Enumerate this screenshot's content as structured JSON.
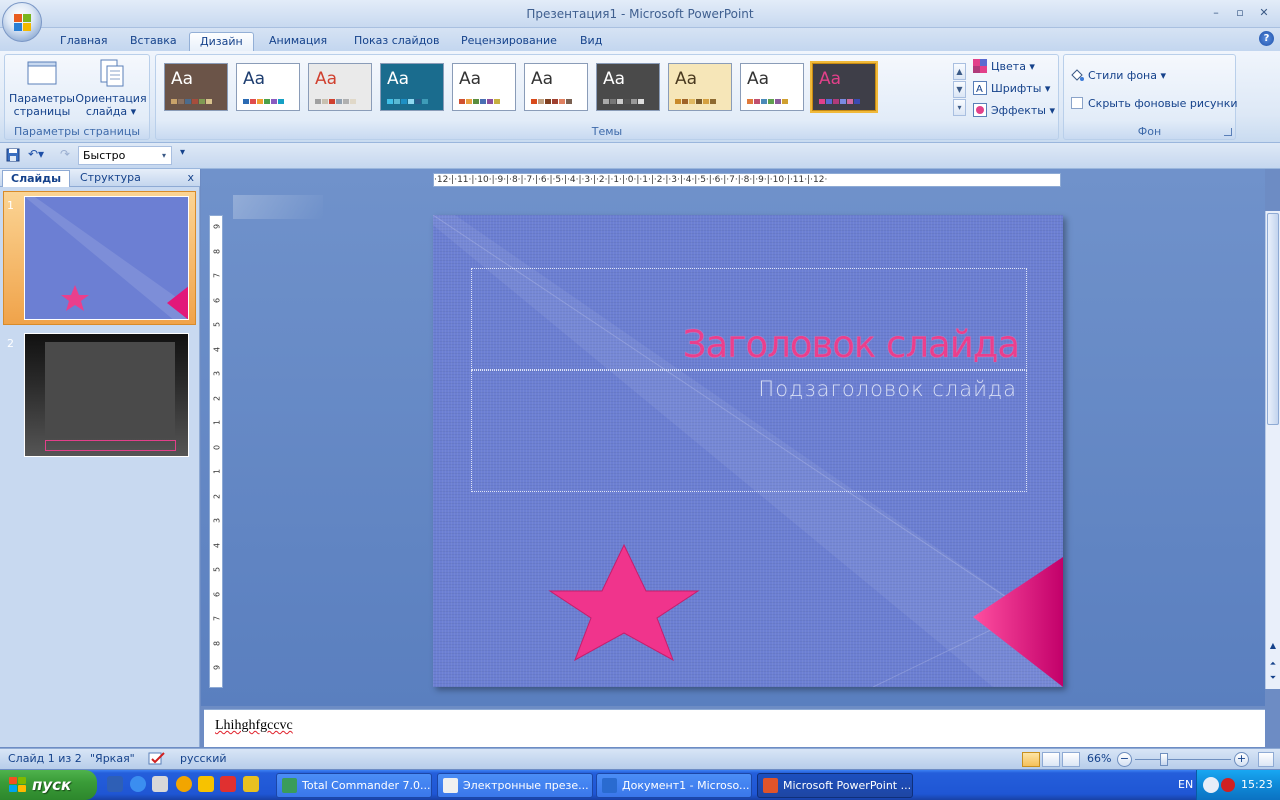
{
  "window": {
    "title": "Презентация1 - Microsoft PowerPoint",
    "ctrl_min": "–",
    "ctrl_max": "▫",
    "ctrl_close": "✕"
  },
  "tabs": [
    "Главная",
    "Вставка",
    "Дизайн",
    "Анимация",
    "Показ слайдов",
    "Рецензирование",
    "Вид"
  ],
  "active_tab": "Дизайн",
  "help": "?",
  "ribbon": {
    "page_setup": {
      "label": "Параметры страницы",
      "params_line1": "Параметры",
      "params_line2": "страницы",
      "orient_line1": "Ориентация",
      "orient_line2": "слайда ▾"
    },
    "themes": {
      "label": "Темы",
      "aa": "Aa",
      "scroll_up": "▲",
      "scroll_down": "▼",
      "scroll_more": "▾",
      "items": [
        {
          "bg": "#6b5448",
          "fg": "#ffffff",
          "sw": [
            "#c9a26a",
            "#8a7060",
            "#4c6b8c",
            "#a64d3c",
            "#7f9b53",
            "#d9c38d"
          ]
        },
        {
          "bg": "#ffffff",
          "fg": "#1e3e70",
          "sw": [
            "#2b6bb3",
            "#e04c4c",
            "#f0a030",
            "#4aa14a",
            "#8a5bc0",
            "#16a0c4"
          ]
        },
        {
          "bg": "#eaeaea",
          "fg": "#d0402f",
          "sw": [
            "#a0a0a0",
            "#c8c0b0",
            "#d0402f",
            "#90a0b0",
            "#b0b0b0",
            "#e0d8c8"
          ]
        },
        {
          "bg": "#1a6c8e",
          "fg": "#ffffff",
          "sw": [
            "#42c0e8",
            "#5ab9d4",
            "#1d8fc4",
            "#8fd8f0",
            "#2a5c8a",
            "#3e9cb8"
          ]
        },
        {
          "bg": "#ffffff",
          "fg": "#333333",
          "sw": [
            "#d05030",
            "#e8a040",
            "#5a8e3e",
            "#4a6fb3",
            "#8c4e9c",
            "#c7b040"
          ]
        },
        {
          "bg": "#ffffff",
          "fg": "#333333",
          "sw": [
            "#d84a1b",
            "#c0a080",
            "#804020",
            "#a04030",
            "#e08060",
            "#7a6050"
          ]
        },
        {
          "bg": "#4a4a4a",
          "fg": "#ffffff",
          "sw": [
            "#aaaaaa",
            "#777777",
            "#cccccc",
            "#555555",
            "#999999",
            "#dddddd"
          ]
        },
        {
          "bg": "#f6e6b8",
          "fg": "#4a3a20",
          "sw": [
            "#c88a2a",
            "#a06428",
            "#e0b860",
            "#7a5a2a",
            "#d4a040",
            "#8e6a30"
          ]
        },
        {
          "bg": "#ffffff",
          "fg": "#333333",
          "sw": [
            "#e07a3a",
            "#c05070",
            "#4a8ab8",
            "#60a050",
            "#8a5a9a",
            "#d0a030"
          ]
        },
        {
          "bg": "#3e3e48",
          "fg": "#e2408a",
          "sw": [
            "#e2408a",
            "#5a6ad0",
            "#b03a7a",
            "#7a8ae0",
            "#d06aa0",
            "#3a4ab0"
          ]
        }
      ],
      "selected_index": 9
    },
    "theme_options": {
      "colors": "Цвета ▾",
      "fonts": "Шрифты ▾",
      "effects": "Эффекты ▾"
    },
    "background": {
      "label": "Фон",
      "styles": "Стили фона ▾",
      "hide": "Скрыть фоновые рисунки"
    }
  },
  "qat": {
    "combo_value": "Быстро",
    "combo_arrow": "▾",
    "customize": "▾"
  },
  "left_pane": {
    "tab_slides": "Слайды",
    "tab_outline": "Структура",
    "close": "x",
    "slide_numbers": [
      "1",
      "2"
    ]
  },
  "ruler": {
    "horizontal": "·12·|·11·|·10·|·9·|·8·|·7·|·6·|·5·|·4·|·3·|·2·|·1·|·0·|·1·|·2·|·3·|·4·|·5·|·6·|·7·|·8·|·9·|·10·|·11·|·12·",
    "vertical": [
      "9",
      "8",
      "7",
      "6",
      "5",
      "4",
      "3",
      "2",
      "1",
      "0",
      "1",
      "2",
      "3",
      "4",
      "5",
      "6",
      "7",
      "8",
      "9"
    ]
  },
  "slide": {
    "title": "Заголовок слайда",
    "subtitle": "Подзаголовок слайда"
  },
  "notes": {
    "text": "Lhihghfgccvc"
  },
  "status": {
    "slide_info": "Слайд 1 из 2",
    "theme_name": "\"Яркая\"",
    "language": "русский",
    "zoom": "66%",
    "zoom_minus": "−",
    "zoom_plus": "+"
  },
  "taskbar": {
    "start": "пуск",
    "tasks": [
      {
        "label": "Total Commander 7.0...",
        "color": "#3a9c5a"
      },
      {
        "label": "Электронные презе...",
        "color": "#f0f0f0"
      },
      {
        "label": "Документ1 - Microso...",
        "color": "#2a6bd0"
      },
      {
        "label": "Microsoft PowerPoint ...",
        "color": "#e0542a"
      }
    ],
    "lang": "EN",
    "time": "15:23"
  },
  "colors": {
    "slide_bg": "#6c7fd3",
    "accent_pink": "#ea3f8c",
    "ribbon_text": "#15428b"
  }
}
